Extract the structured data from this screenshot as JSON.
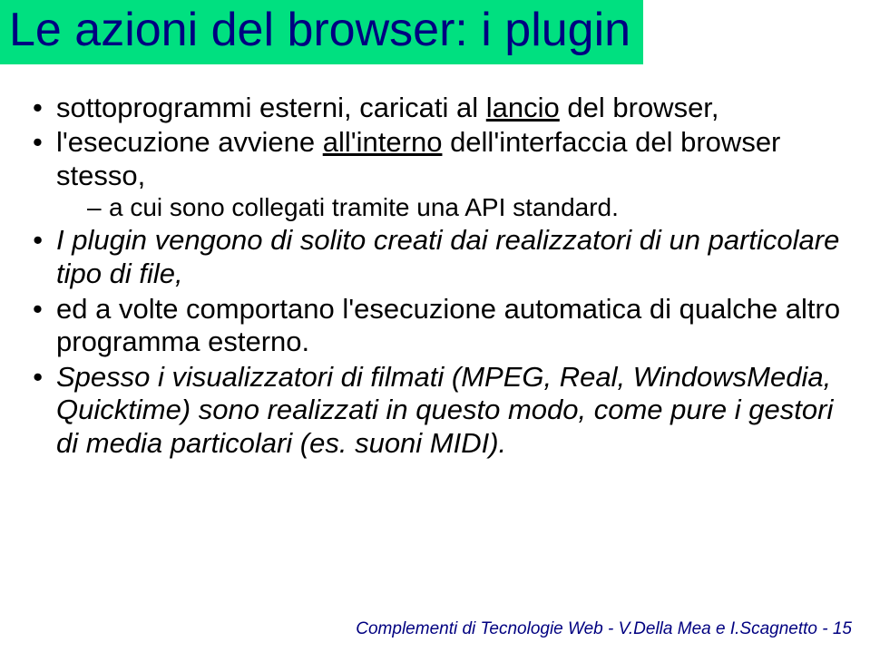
{
  "title": "Le azioni del browser: i plugin",
  "bullets": {
    "b1_pre": "sottoprogrammi esterni, caricati al ",
    "b1_u": "lancio",
    "b1_post": " del browser,",
    "b2_pre": "l'esecuzione avviene ",
    "b2_u": "all'interno",
    "b2_post": " dell'interfaccia del browser stesso,",
    "b2_sub": "a cui sono collegati tramite una API standard.",
    "b3": "I plugin vengono di solito creati dai realizzatori di un particolare tipo di file,",
    "b4": "ed a volte comportano l'esecuzione automatica di qualche altro programma esterno.",
    "b5": "Spesso i visualizzatori di filmati (MPEG, Real, WindowsMedia, Quicktime) sono realizzati in questo modo, come pure  i gestori di media particolari (es. suoni MIDI)."
  },
  "footer": {
    "text": "Complementi di Tecnologie Web - V.Della Mea e I.Scagnetto - ",
    "page": "15"
  }
}
